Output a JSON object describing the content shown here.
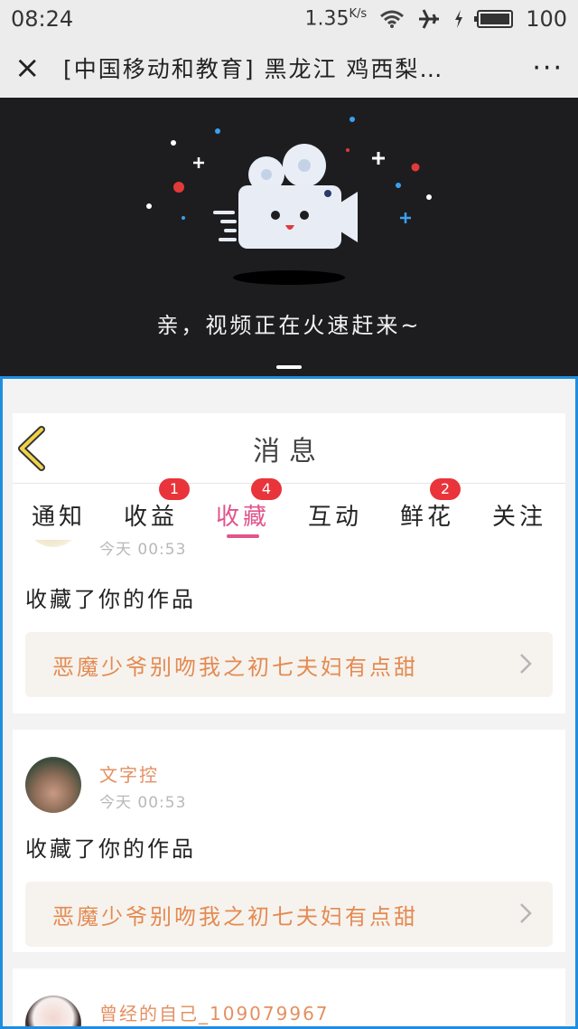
{
  "status_bar": {
    "time": "08:24",
    "net_speed": "1.35",
    "net_unit": "K/s",
    "battery": "100",
    "icons": [
      "wifi-icon",
      "airplane-icon",
      "charging-icon",
      "battery-icon"
    ]
  },
  "title_bar": {
    "close_label": "×",
    "title": "[中国移动和教育] 黑龙江 鸡西梨…",
    "more_label": "···"
  },
  "video": {
    "loading_text": "亲，视频正在火速赶来~"
  },
  "messages_page": {
    "header_title": "消息",
    "tabs": [
      {
        "label": "通知",
        "badge": ""
      },
      {
        "label": "收益",
        "badge": "1"
      },
      {
        "label": "收藏",
        "badge": "4",
        "active": true
      },
      {
        "label": "互动",
        "badge": ""
      },
      {
        "label": "鲜花",
        "badge": "2"
      },
      {
        "label": "关注",
        "badge": ""
      }
    ],
    "items": [
      {
        "username": "",
        "time": "今天 00:53",
        "action": "收藏了你的作品",
        "work_title": "恶魔少爷别吻我之初七夫妇有点甜"
      },
      {
        "username": "文字控",
        "time": "今天 00:53",
        "action": "收藏了你的作品",
        "work_title": "恶魔少爷别吻我之初七夫妇有点甜"
      },
      {
        "username": "曾经的自己_109079967",
        "time": "",
        "action": "",
        "work_title": ""
      }
    ]
  },
  "colors": {
    "accent": "#e2548a",
    "badge": "#e8343a",
    "username": "#e39062",
    "work_title": "#e48a52",
    "panel_border": "#1f8de0",
    "back_arrow": "#f0d24a"
  }
}
